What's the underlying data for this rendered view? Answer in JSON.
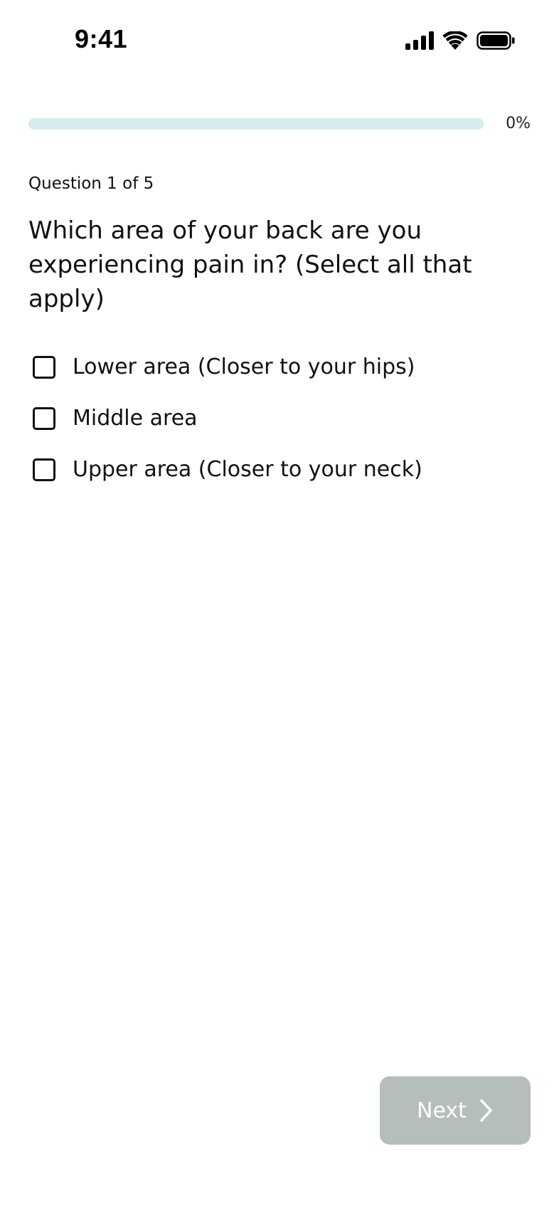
{
  "status_bar": {
    "time": "9:41",
    "icons": [
      "cellular-signal-icon",
      "wifi-icon",
      "battery-icon"
    ]
  },
  "progress": {
    "percent": 0,
    "label": "0%"
  },
  "question": {
    "counter": "Question 1 of 5",
    "title": "Which area of your back are you experiencing pain in? (Select all that apply)"
  },
  "options": [
    {
      "label": "Lower area (Closer to your hips)",
      "checked": false
    },
    {
      "label": "Middle area",
      "checked": false
    },
    {
      "label": "Upper area (Closer to your neck)",
      "checked": false
    }
  ],
  "footer": {
    "next_label": "Next",
    "next_icon": "chevron-right-icon",
    "next_disabled": true
  },
  "colors": {
    "progress_track": "#d5ecee",
    "button_disabled": "#b5bdbd",
    "text": "#111111"
  }
}
